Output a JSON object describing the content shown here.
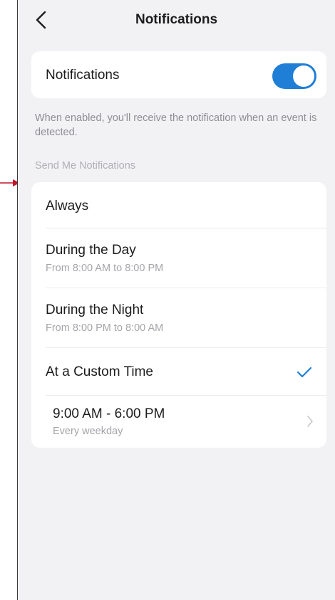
{
  "nav": {
    "back_icon": "chevron-left-icon",
    "title": "Notifications"
  },
  "master_toggle": {
    "label": "Notifications",
    "enabled": true,
    "color": "#1f7fd6"
  },
  "description": "When enabled, you'll receive the notification when an event is detected.",
  "section_label": "Send Me Notifications",
  "options": [
    {
      "title": "Always",
      "subtitle": ""
    },
    {
      "title": "During the Day",
      "subtitle": "From 8:00 AM to 8:00 PM"
    },
    {
      "title": "During the Night",
      "subtitle": "From 8:00 PM to 8:00 AM"
    },
    {
      "title": "At a Custom Time",
      "subtitle": "",
      "selected": true
    }
  ],
  "custom_schedule": {
    "time_range": "9:00 AM - 6:00 PM",
    "repeat": "Every weekday"
  },
  "annotation": {
    "icon": "arrow-right-icon",
    "color": "#c0152a"
  }
}
